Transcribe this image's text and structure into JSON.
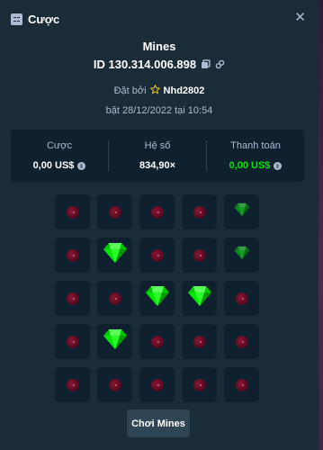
{
  "header": {
    "title": "Cược",
    "icon": "receipt-icon",
    "close_icon": "close-icon",
    "close_glyph": "✕"
  },
  "game": {
    "name": "Mines",
    "id": "ID 130.314.006.898",
    "copy_icon": "copy-icon",
    "link_icon": "link-icon",
    "placed_by_label": "Đặt bởi",
    "star_icon": "star-icon",
    "username": "Nhd2802",
    "date": "bặt 28/12/2022 tại 10:54"
  },
  "stats": [
    {
      "label": "Cược",
      "value": "0,00 US$",
      "coin": true,
      "color": "#ffffff"
    },
    {
      "label": "Hệ số",
      "value": "834,90×",
      "coin": false,
      "color": "#ffffff"
    },
    {
      "label": "Thanh toán",
      "value": "0,00 US$",
      "coin": true,
      "color": "#00e701"
    }
  ],
  "grid": {
    "rows": 5,
    "cols": 5,
    "tiles": [
      [
        "mine",
        "mine",
        "mine",
        "mine",
        "gem-dim"
      ],
      [
        "mine",
        "gem",
        "mine",
        "mine",
        "gem-dim"
      ],
      [
        "mine",
        "mine",
        "gem",
        "gem",
        "mine"
      ],
      [
        "mine",
        "gem",
        "mine",
        "mine",
        "mine"
      ],
      [
        "mine",
        "mine",
        "mine",
        "mine",
        "mine"
      ]
    ]
  },
  "play_button": {
    "label": "Chơi Mines"
  },
  "colors": {
    "background": "#1a2c38",
    "panel": "#0f212e",
    "gem": "#00e701",
    "muted": "#b1bad3"
  }
}
